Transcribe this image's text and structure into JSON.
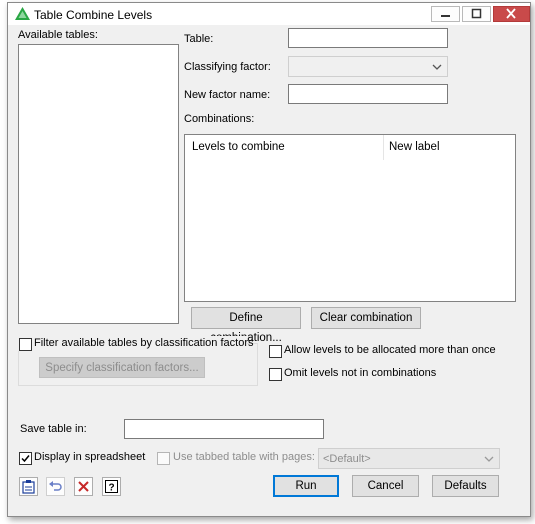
{
  "window": {
    "title": "Table Combine Levels"
  },
  "left_panel": {
    "available_tables_label": "Available tables:",
    "available_tables_items": []
  },
  "form": {
    "table_label": "Table:",
    "table_value": "",
    "classifying_factor_label": "Classifying factor:",
    "classifying_factor_value": "",
    "new_factor_name_label": "New factor name:",
    "new_factor_name_value": "",
    "combinations_label": "Combinations:",
    "combinations_columns": [
      "Levels to combine",
      "New label"
    ],
    "combinations_rows": []
  },
  "buttons": {
    "define_combination": "Define combination...",
    "clear_combination": "Clear combination",
    "specify_classification_factors": "Specify classification factors...",
    "run": "Run",
    "cancel": "Cancel",
    "defaults": "Defaults"
  },
  "options": {
    "filter_tables_label": "Filter available tables by classification factors",
    "filter_tables_checked": false,
    "allow_multiple_label": "Allow levels to be allocated more than once",
    "allow_multiple_checked": false,
    "omit_levels_label": "Omit levels not in combinations",
    "omit_levels_checked": false
  },
  "save": {
    "save_table_label": "Save table in:",
    "save_table_value": "",
    "display_spreadsheet_label": "Display in spreadsheet",
    "display_spreadsheet_checked": true,
    "tabbed_table_label": "Use tabbed table with pages:",
    "tabbed_table_checked": false,
    "tabbed_table_value": "<Default>"
  },
  "toolbar": {
    "icons": [
      "clipboard-icon",
      "undo-icon",
      "clear-icon",
      "help-icon"
    ]
  },
  "colors": {
    "accent": "#2aa745",
    "close_button": "#c94a4a"
  }
}
